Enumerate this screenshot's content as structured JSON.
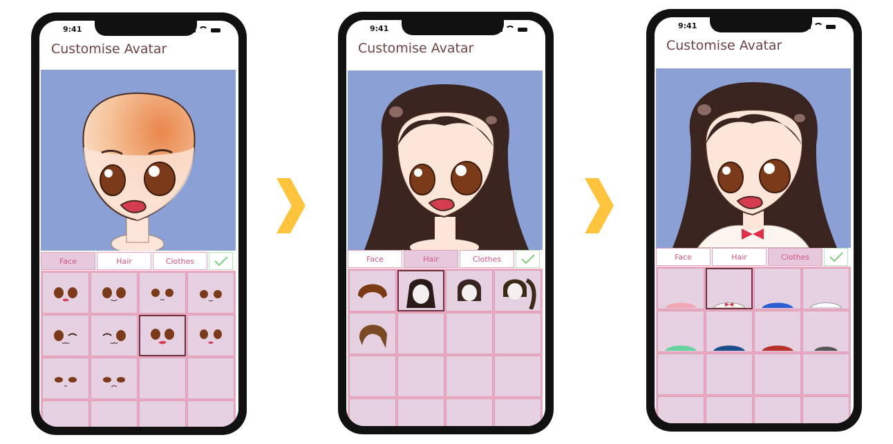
{
  "screens": [
    {
      "status_time": "9:41",
      "title": "Customise Avatar",
      "tabs": [
        "Face",
        "Hair",
        "Clothes"
      ],
      "active_tab": "Face",
      "grid_items": [
        "face-1",
        "face-2",
        "face-3",
        "face-4",
        "face-5",
        "face-6",
        "face-7-selected",
        "face-8",
        "face-9",
        "face-10"
      ],
      "selected_index": 6
    },
    {
      "status_time": "9:41",
      "title": "Customise Avatar",
      "tabs": [
        "Face",
        "Hair",
        "Clothes"
      ],
      "active_tab": "Hair",
      "grid_items": [
        "hair-bowl",
        "hair-long-selected",
        "hair-bob",
        "hair-ponytail",
        "hair-brown-side"
      ],
      "selected_index": 1
    },
    {
      "status_time": "9:41",
      "title": "Customise Avatar",
      "tabs": [
        "Face",
        "Hair",
        "Clothes"
      ],
      "active_tab": "Clothes",
      "grid_items": [
        "clothes-pink",
        "clothes-white-bow-selected",
        "clothes-blue",
        "clothes-white",
        "clothes-green",
        "clothes-navy",
        "clothes-red",
        "clothes-grey"
      ],
      "selected_index": 1
    }
  ],
  "colors": {
    "stage_bg": "#8ba0d5",
    "arrow": "#ffc43d",
    "tab_text": "#d2557d",
    "title_text": "#6d4343",
    "cell_bg": "#e5d1e2"
  }
}
